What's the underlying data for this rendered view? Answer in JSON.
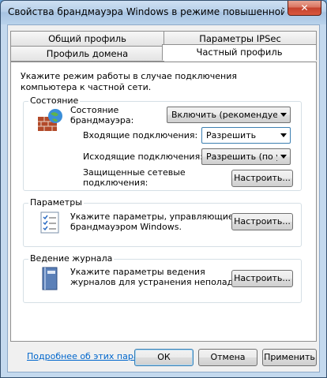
{
  "window": {
    "title": "Свойства брандмауэра Windows в режиме повышенной безо...",
    "close_glyph": "✕"
  },
  "tabs": {
    "row1": [
      "Общий профиль",
      "Параметры IPSec"
    ],
    "row2": [
      "Профиль домена",
      "Частный профиль"
    ],
    "active": "Частный профиль"
  },
  "description": "Укажите режим работы в случае подключения компьютера к частной сети.",
  "state": {
    "group_label": "Состояние",
    "firewall_state_label_line1": "Состояние",
    "firewall_state_label_line2": "брандмауэра:",
    "firewall_state_value": "Включить (рекомендуется",
    "inbound_label": "Входящие подключения:",
    "inbound_value": "Разрешить",
    "outbound_label": "Исходящие подключения:",
    "outbound_value": "Разрешить (по ум",
    "protected_label_line1": "Защищенные сетевые",
    "protected_label_line2": "подключения:",
    "configure_label": "Настроить...",
    "icon": "firewall-icon"
  },
  "settings": {
    "group_label": "Параметры",
    "text_line1": "Укажите параметры, управляющие",
    "text_line2": "брандмауэром Windows.",
    "configure_label": "Настроить...",
    "icon": "settings-list-icon"
  },
  "logging": {
    "group_label": "Ведение журнала",
    "text_line1": "Укажите параметры ведения",
    "text_line2": "журналов для устранения неполадок.",
    "configure_label": "Настроить...",
    "icon": "log-notebook-icon"
  },
  "more_link": "Подробнее об этих параметрах",
  "buttons": {
    "ok": "ОК",
    "cancel": "Отмена",
    "apply": "Применить"
  },
  "colors": {
    "accent": "#3c7fb1",
    "link": "#0066cc",
    "close": "#c4422d"
  }
}
